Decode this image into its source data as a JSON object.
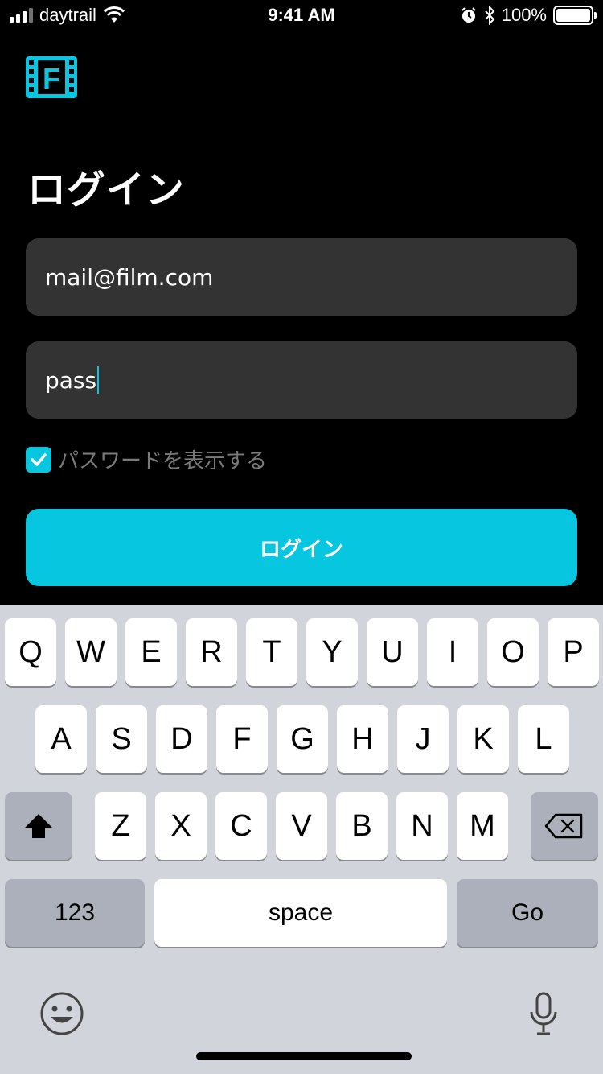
{
  "status_bar": {
    "carrier": "daytrail",
    "time": "9:41 AM",
    "battery": "100%"
  },
  "app": {
    "logo_letter": "F",
    "accent_color": "#06c6e0"
  },
  "login": {
    "title": "ログイン",
    "email_value": "mail@film.com",
    "password_value": "pass",
    "show_password_label": "パスワードを表示する",
    "show_password_checked": true,
    "login_button": "ログイン"
  },
  "keyboard": {
    "row1": [
      "Q",
      "W",
      "E",
      "R",
      "T",
      "Y",
      "U",
      "I",
      "O",
      "P"
    ],
    "row2": [
      "A",
      "S",
      "D",
      "F",
      "G",
      "H",
      "J",
      "K",
      "L"
    ],
    "row3": [
      "Z",
      "X",
      "C",
      "V",
      "B",
      "N",
      "M"
    ],
    "numbers_key": "123",
    "space_key": "space",
    "return_key": "Go",
    "icons": [
      "shift-icon",
      "backspace-icon",
      "emoji-icon",
      "microphone-icon"
    ]
  }
}
